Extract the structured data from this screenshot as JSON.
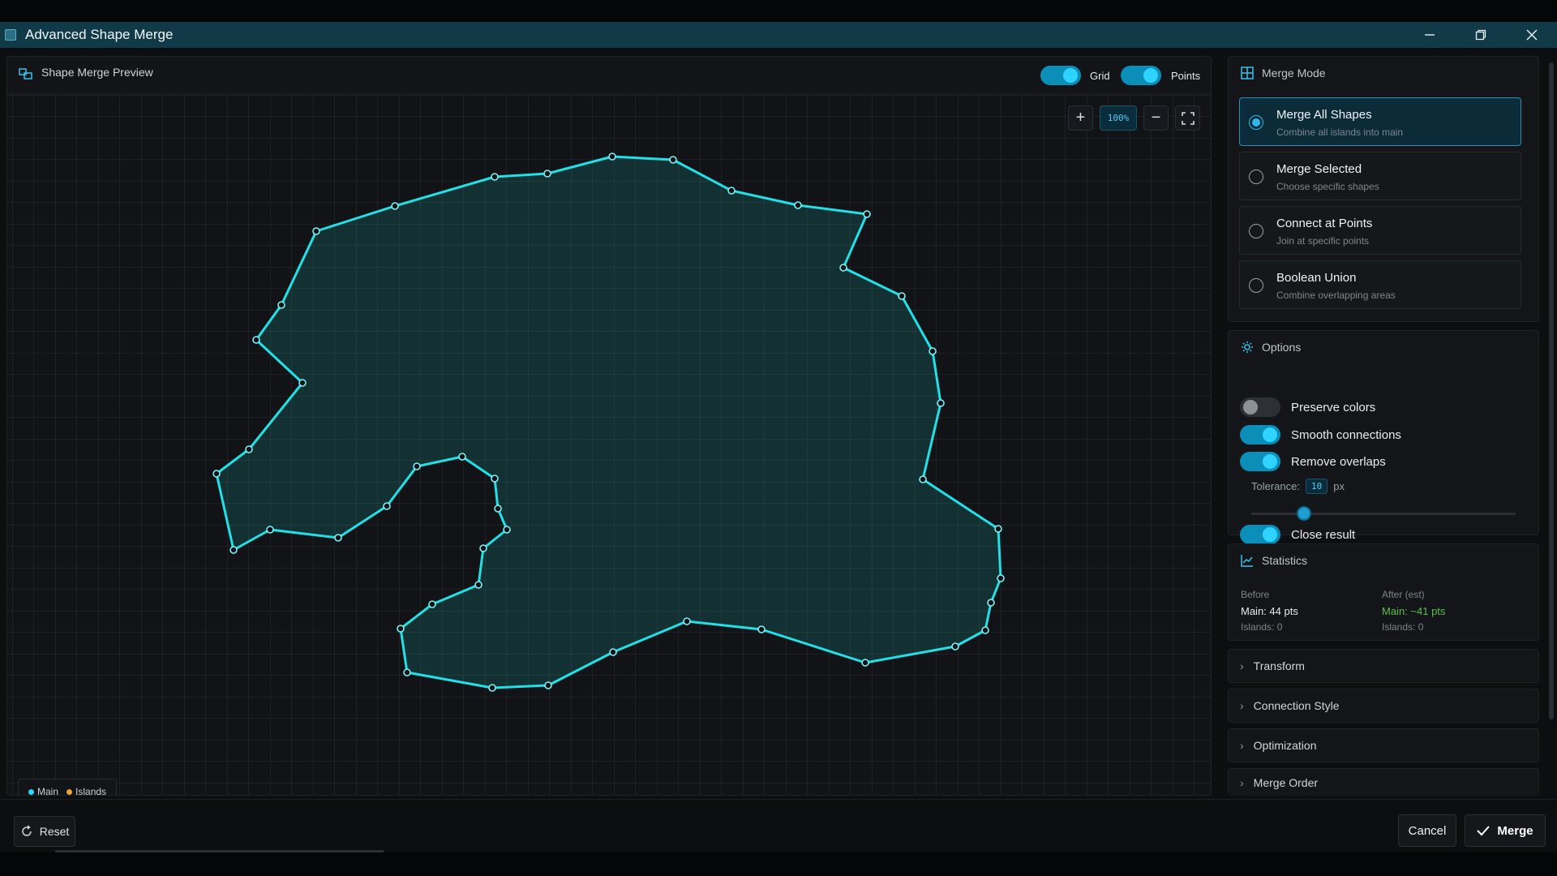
{
  "window": {
    "title": "Advanced Shape Merge",
    "minimize_icon": "minimize-icon",
    "maximize_icon": "restore-icon",
    "close_icon": "close-icon"
  },
  "preview": {
    "title": "Shape Merge Preview",
    "icon": "shapes-icon",
    "grid_label": "Grid",
    "points_label": "Points",
    "grid_on": true,
    "points_on": true,
    "zoom": {
      "in_icon": "plus-icon",
      "level": "100%",
      "out_icon": "minus-icon",
      "fit_icon": "fullscreen-icon"
    },
    "legend": [
      {
        "label": "Main",
        "color": "#2fd3ff"
      },
      {
        "label": "Islands",
        "color": "#f0a23a"
      }
    ],
    "shape_color": "#22e0e6"
  },
  "merge_mode": {
    "title": "Merge Mode",
    "icon": "grid-icon",
    "options": [
      {
        "title": "Merge All Shapes",
        "subtitle": "Combine all islands into main",
        "selected": true
      },
      {
        "title": "Merge Selected",
        "subtitle": "Choose specific shapes",
        "selected": false
      },
      {
        "title": "Connect at Points",
        "subtitle": "Join at specific points",
        "selected": false
      },
      {
        "title": "Boolean Union",
        "subtitle": "Combine overlapping areas",
        "selected": false
      }
    ]
  },
  "options": {
    "title": "Options",
    "icon": "settings-icon",
    "preserve_colors": {
      "label": "Preserve colors",
      "on": false
    },
    "smooth_connections": {
      "label": "Smooth connections",
      "on": true
    },
    "remove_overlaps": {
      "label": "Remove overlaps",
      "on": true
    },
    "tolerance": {
      "label": "Tolerance:",
      "value": "10",
      "unit": "px",
      "slider_fraction": 0.2
    },
    "close_result": {
      "label": "Close result",
      "on": true
    }
  },
  "statistics": {
    "title": "Statistics",
    "icon": "chart-icon",
    "before": {
      "label": "Before",
      "main": "Main: 44 pts",
      "islands": "Islands: 0"
    },
    "after": {
      "label": "After (est)",
      "main": "Main: ~41 pts",
      "islands": "Islands: 0"
    }
  },
  "sections": [
    "Transform",
    "Connection Style",
    "Optimization",
    "Merge Order"
  ],
  "footer": {
    "reset_label": "Reset",
    "cancel_label": "Cancel",
    "merge_label": "Merge"
  }
}
